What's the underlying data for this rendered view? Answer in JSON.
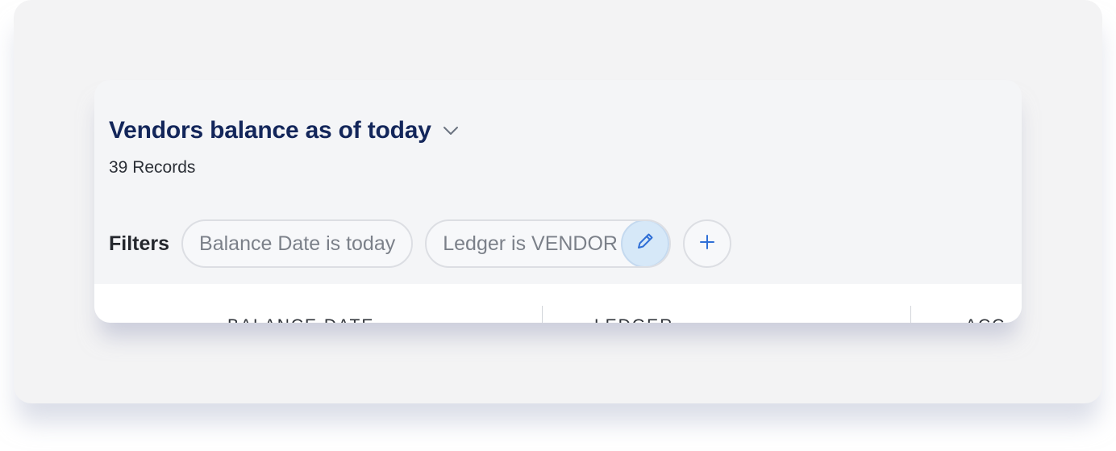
{
  "report": {
    "title": "Vendors balance as of today",
    "records": "39 Records",
    "icons": {
      "title_dropdown": "chevron-down-icon",
      "edit": "pencil-icon",
      "add": "plus-icon"
    }
  },
  "filters": {
    "label": "Filters",
    "chips": [
      {
        "text": "Balance Date is today"
      },
      {
        "text": "Ledger is VENDOR"
      }
    ],
    "accent_color": "#2f6fd6"
  },
  "table": {
    "columns": [
      "BALANCE DATE",
      "LEDGER",
      "ACC"
    ]
  },
  "colors": {
    "title": "#13265a",
    "edit_button_bg": "#d6e8f8"
  }
}
